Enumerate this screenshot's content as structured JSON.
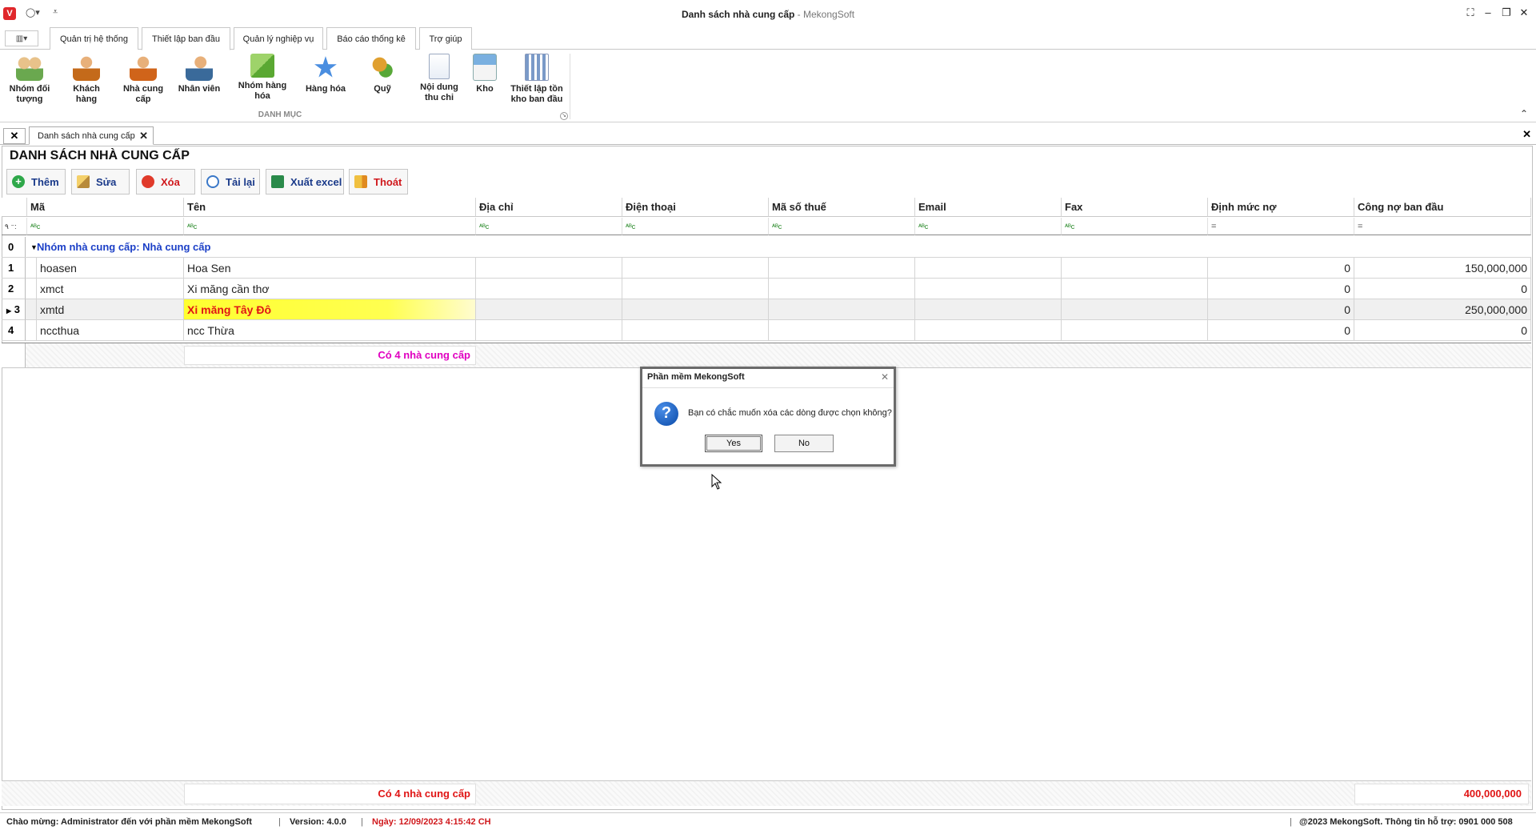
{
  "window": {
    "title": "Danh sách nhà cung cấp",
    "title_sep": " - ",
    "app_name": "MekongSoft"
  },
  "ribbon": {
    "tabs": [
      {
        "label": "Quản trị hệ thống"
      },
      {
        "label": "Thiết lập ban đầu"
      },
      {
        "label": "Quản lý nghiệp vụ"
      },
      {
        "label": "Báo cáo thống kê"
      },
      {
        "label": "Trợ giúp"
      }
    ],
    "items": [
      {
        "label": "Nhóm đối\ntượng",
        "icon": "users-group-icon"
      },
      {
        "label": "Khách\nhàng",
        "icon": "customer-icon"
      },
      {
        "label": "Nhà cung\ncấp",
        "icon": "supplier-icon"
      },
      {
        "label": "Nhân viên",
        "icon": "employee-icon"
      },
      {
        "label": "Nhóm hàng\nhóa",
        "icon": "product-group-icon"
      },
      {
        "label": "Hàng hóa",
        "icon": "star-icon"
      },
      {
        "label": "Quỹ",
        "icon": "coins-icon"
      },
      {
        "label": "Nội dung\nthu chi",
        "icon": "document-add-icon"
      },
      {
        "label": "Kho",
        "icon": "warehouse-icon"
      },
      {
        "label": "Thiết lập tồn\nkho ban đầu",
        "icon": "inventory-icon"
      }
    ],
    "group_label": "DANH MỤC"
  },
  "document_tab": {
    "label": "Danh sách nhà cung cấp"
  },
  "page": {
    "title": "DANH SÁCH NHÀ CUNG CẤP"
  },
  "toolbar": {
    "add": "Thêm",
    "edit": "Sửa",
    "delete": "Xóa",
    "reload": "Tải lại",
    "export": "Xuất excel",
    "exit": "Thoát"
  },
  "grid": {
    "columns": [
      "Mã",
      "Tên",
      "Địa chỉ",
      "Điện thoại",
      "Mã số thuế",
      "Email",
      "Fax",
      "Định mức nợ",
      "Công nợ ban đầu"
    ],
    "filter_text_glyph": "ᴬᴮc",
    "filter_eq_glyph": "=",
    "filter_row_icon": "٩ ⁻:",
    "group_row": {
      "num": "0",
      "label": "Nhóm nhà cung cấp: Nhà cung cấp"
    },
    "rows": [
      {
        "num": "1",
        "ma": "hoasen",
        "ten": "Hoa Sen",
        "dinh_muc_no": "0",
        "cong_no": "150,000,000"
      },
      {
        "num": "2",
        "ma": "xmct",
        "ten": "Xi măng cần thơ",
        "dinh_muc_no": "0",
        "cong_no": "0"
      },
      {
        "num": "3",
        "ma": "xmtd",
        "ten": "Xi măng Tây Đô",
        "dinh_muc_no": "0",
        "cong_no": "250,000,000"
      },
      {
        "num": "4",
        "ma": "nccthua",
        "ten": "ncc Thừa",
        "dinh_muc_no": "0",
        "cong_no": "0"
      }
    ],
    "group_summary": "Có 4 nhà cung cấp",
    "footer_count": "Có 4 nhà cung cấp",
    "footer_total": "400,000,000"
  },
  "dialog": {
    "title": "Phần mềm MekongSoft",
    "message": "Bạn có chắc muốn xóa các dòng được chọn không?",
    "yes": "Yes",
    "no": "No",
    "icon_glyph": "?"
  },
  "statusbar": {
    "welcome": "Chào mừng: Administrator đến với phần mềm MekongSoft",
    "version": "Version: 4.0.0",
    "date": "Ngày: 12/09/2023 4:15:42 CH",
    "copyright": "@2023 MekongSoft. Thông tin hỗ trợ: 0901 000 508"
  },
  "colors": {
    "accent_blue": "#1b3fc7",
    "red": "#e01515",
    "highlight_yellow": "#ffff30",
    "magenta": "#e000c0"
  }
}
